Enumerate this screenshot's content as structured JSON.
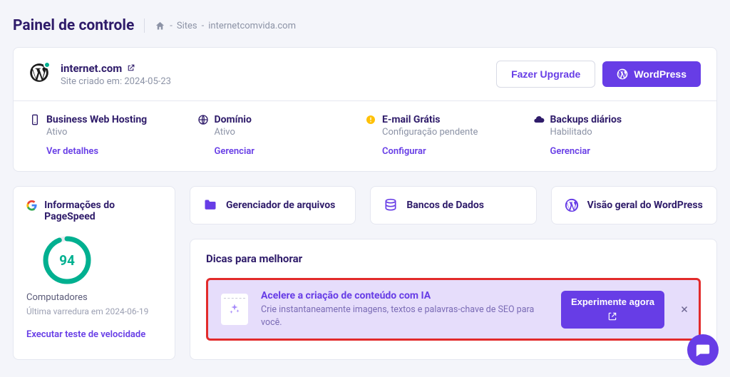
{
  "header": {
    "title": "Painel de controle",
    "breadcrumb_sites": "Sites",
    "breadcrumb_domain": "internetcomvida.com"
  },
  "site": {
    "name": "internet.com",
    "created_label": "Site criado em: 2024-05-23",
    "upgrade_btn": "Fazer Upgrade",
    "wordpress_btn": "WordPress"
  },
  "status": [
    {
      "title": "Business Web Hosting",
      "sub": "Ativo",
      "link": "Ver detalhes"
    },
    {
      "title": "Domínio",
      "sub": "Ativo",
      "link": "Gerenciar"
    },
    {
      "title": "E-mail Grátis",
      "sub": "Configuração pendente",
      "link": "Configurar"
    },
    {
      "title": "Backups diários",
      "sub": "Habilitado",
      "link": "Gerenciar"
    }
  ],
  "pagespeed": {
    "title": "Informações do PageSpeed",
    "score": "94",
    "device": "Computadores",
    "scan": "Última varredura em 2024-06-19",
    "action": "Executar teste de velocidade"
  },
  "tools": [
    {
      "label": "Gerenciador de arquivos"
    },
    {
      "label": "Bancos de Dados"
    },
    {
      "label": "Visão geral do WordPress"
    }
  ],
  "tips": {
    "section_title": "Dicas para melhorar",
    "title": "Acelere a criação de conteúdo com IA",
    "desc": "Crie instantaneamente imagens, textos e palavras-chave de SEO para você.",
    "cta": "Experimente agora"
  }
}
